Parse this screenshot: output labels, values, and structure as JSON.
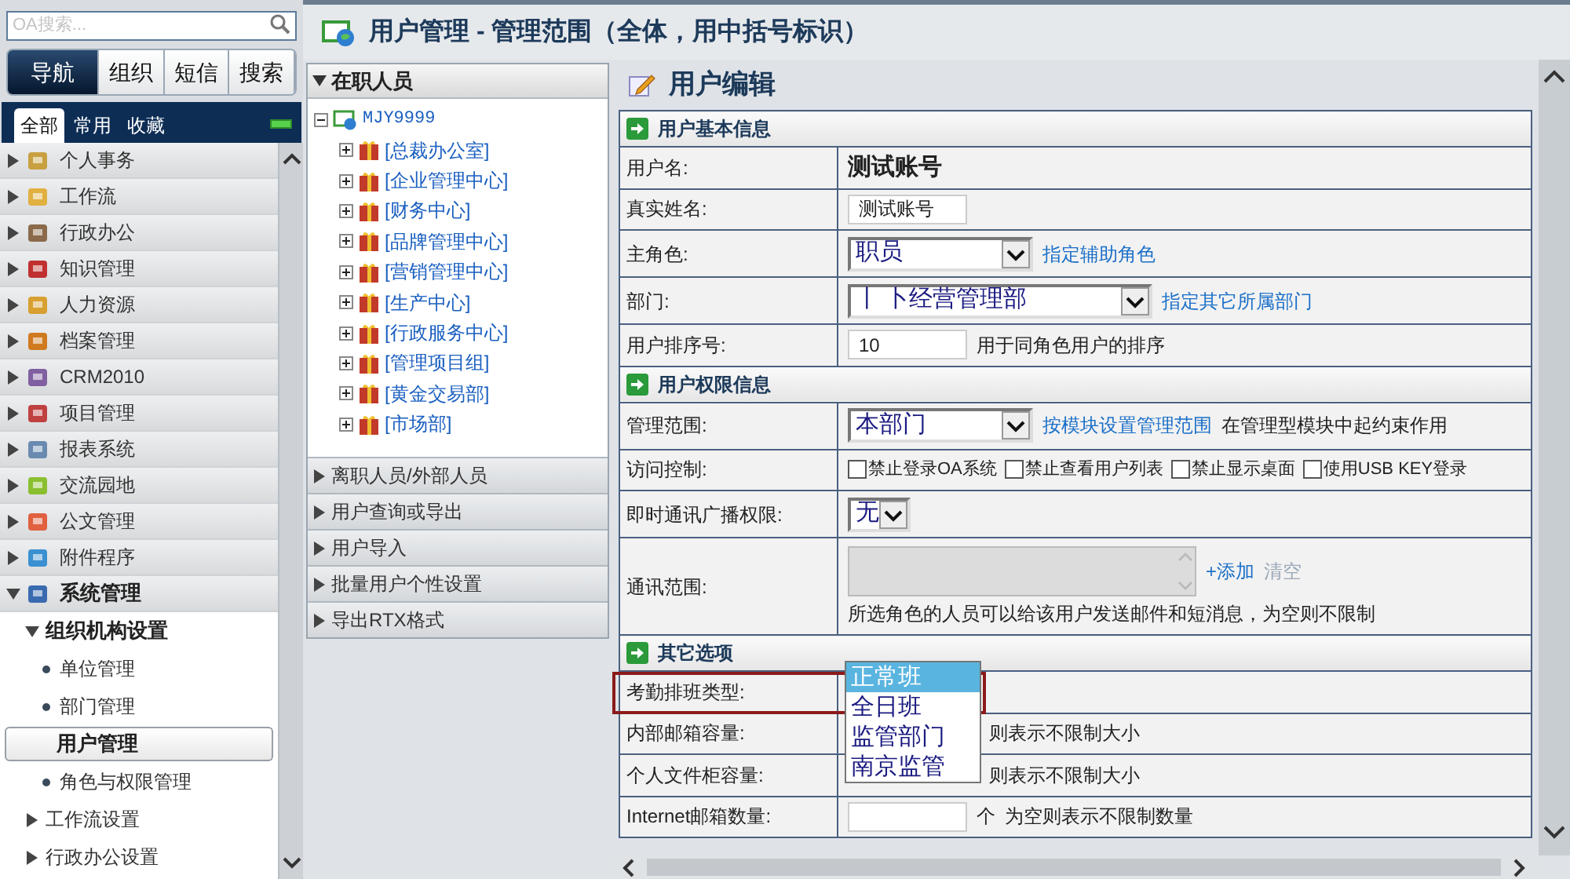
{
  "search": {
    "placeholder": "OA搜索..."
  },
  "nav_tabs": [
    {
      "label": "导航",
      "selected": true
    },
    {
      "label": "组织",
      "selected": false
    },
    {
      "label": "短信",
      "selected": false
    },
    {
      "label": "搜索",
      "selected": false
    }
  ],
  "sub_tabs": [
    {
      "label": "全部",
      "selected": true
    },
    {
      "label": "常用",
      "selected": false
    },
    {
      "label": "收藏",
      "selected": false
    }
  ],
  "menu": [
    {
      "label": "个人事务",
      "expanded": false
    },
    {
      "label": "工作流",
      "expanded": false
    },
    {
      "label": "行政办公",
      "expanded": false
    },
    {
      "label": "知识管理",
      "expanded": false
    },
    {
      "label": "人力资源",
      "expanded": false
    },
    {
      "label": "档案管理",
      "expanded": false
    },
    {
      "label": "CRM2010",
      "expanded": false
    },
    {
      "label": "项目管理",
      "expanded": false
    },
    {
      "label": "报表系统",
      "expanded": false
    },
    {
      "label": "交流园地",
      "expanded": false
    },
    {
      "label": "公文管理",
      "expanded": false
    },
    {
      "label": "附件程序",
      "expanded": false
    },
    {
      "label": "系统管理",
      "expanded": true,
      "children": [
        {
          "label": "组织机构设置",
          "expanded": true,
          "children": [
            {
              "label": "单位管理",
              "selected": false
            },
            {
              "label": "部门管理",
              "selected": false
            },
            {
              "label": "用户管理",
              "selected": true
            },
            {
              "label": "角色与权限管理",
              "selected": false
            }
          ]
        },
        {
          "label": "工作流设置",
          "expanded": false
        },
        {
          "label": "行政办公设置",
          "expanded": false
        }
      ]
    }
  ],
  "page_title": "用户管理 - 管理范围（全体，用中括号标识）",
  "org_panel": {
    "header": "在职人员",
    "expanded": true,
    "tree": {
      "label": "MJY9999",
      "expanded": true,
      "children": [
        {
          "label": "[总裁办公室]",
          "expanded": false
        },
        {
          "label": "[企业管理中心]",
          "expanded": false
        },
        {
          "label": "[财务中心]",
          "expanded": false
        },
        {
          "label": "[品牌管理中心]",
          "expanded": false
        },
        {
          "label": "[营销管理中心]",
          "expanded": false
        },
        {
          "label": "[生产中心]",
          "expanded": false
        },
        {
          "label": "[行政服务中心]",
          "expanded": false
        },
        {
          "label": "[管理项目组]",
          "expanded": false
        },
        {
          "label": "[黄金交易部]",
          "expanded": false
        },
        {
          "label": "[市场部]",
          "expanded": false
        }
      ]
    },
    "sections": [
      {
        "label": "离职人员/外部人员",
        "expanded": false
      },
      {
        "label": "用户查询或导出",
        "expanded": false
      },
      {
        "label": "用户导入",
        "expanded": false
      },
      {
        "label": "批量用户个性设置",
        "expanded": false
      },
      {
        "label": "导出RTX格式",
        "expanded": false
      }
    ]
  },
  "form_title": "用户编辑",
  "sections": [
    {
      "title": "用户基本信息",
      "rows": [
        {
          "label": "用户名:",
          "fields": [
            {
              "kind": "text",
              "text": "测试账号"
            }
          ]
        },
        {
          "label": "真实姓名:",
          "fields": [
            {
              "kind": "input",
              "value": "测试账号"
            }
          ]
        },
        {
          "label": "主角色:",
          "fields": [
            {
              "kind": "select",
              "value": "职员"
            },
            {
              "kind": "link",
              "text": "指定辅助角色"
            }
          ]
        },
        {
          "label": "部门:",
          "fields": [
            {
              "kind": "wide_select",
              "value": "丨 卜经营管理部"
            },
            {
              "kind": "link",
              "text": "指定其它所属部门"
            }
          ]
        },
        {
          "label": "用户排序号:",
          "fields": [
            {
              "kind": "input",
              "value": "10"
            },
            {
              "kind": "note",
              "text": "用于同角色用户的排序"
            }
          ]
        }
      ]
    },
    {
      "title": "用户权限信息",
      "rows": [
        {
          "label": "管理范围:",
          "fields": [
            {
              "kind": "select",
              "value": "本部门"
            },
            {
              "kind": "link",
              "text": "按模块设置管理范围"
            },
            {
              "kind": "note",
              "text": "在管理型模块中起约束作用"
            }
          ]
        },
        {
          "label": "访问控制:",
          "fields": [
            {
              "kind": "checkbox",
              "text": "禁止登录OA系统",
              "checked": false
            },
            {
              "kind": "checkbox",
              "text": "禁止查看用户列表",
              "checked": false
            },
            {
              "kind": "checkbox",
              "text": "禁止显示桌面",
              "checked": false
            },
            {
              "kind": "checkbox",
              "text": "使用USB KEY登录",
              "checked": false
            }
          ]
        },
        {
          "label": "即时通讯广播权限:",
          "fields": [
            {
              "kind": "select",
              "value": "无"
            }
          ]
        },
        {
          "label": "通讯范围:",
          "fields": [
            {
              "kind": "textarea",
              "disabled": true
            },
            {
              "kind": "link",
              "text": "+添加",
              "disabled": false
            },
            {
              "kind": "link",
              "text": "清空",
              "disabled": true
            },
            {
              "kind": "block_note",
              "text": "所选角色的人员可以给该用户发送邮件和短消息，为空则不限制"
            }
          ]
        }
      ]
    },
    {
      "title": "其它选项",
      "rows": [
        {
          "label": "考勤排班类型:",
          "highlighted": true,
          "fields": [
            {
              "kind": "listbox",
              "options": [
                {
                  "label": "正常班",
                  "selected": true
                },
                {
                  "label": "全日班",
                  "selected": false
                },
                {
                  "label": "监管部门",
                  "selected": false
                },
                {
                  "label": "南京监管",
                  "selected": false
                }
              ]
            }
          ]
        },
        {
          "label": "内部邮箱容量:",
          "fields": [
            {
              "kind": "covered_note",
              "text": "则表示不限制大小"
            }
          ]
        },
        {
          "label": "个人文件柜容量:",
          "fields": [
            {
              "kind": "covered_note",
              "text": "则表示不限制大小"
            }
          ]
        },
        {
          "label": "Internet邮箱数量:",
          "fields": [
            {
              "kind": "input"
            },
            {
              "kind": "note",
              "text": "个"
            },
            {
              "kind": "note",
              "text": "为空则表示不限制数量"
            }
          ]
        }
      ]
    }
  ]
}
